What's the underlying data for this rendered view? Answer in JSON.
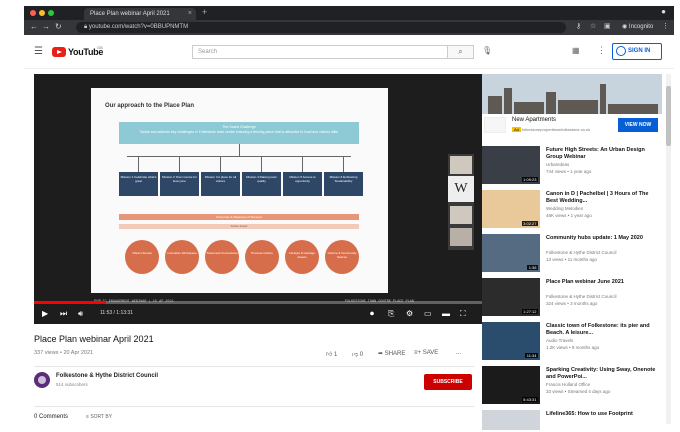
{
  "browser": {
    "tab_title": "Place Plan webinar April 2021",
    "tab_close": "×",
    "new_tab": "+",
    "url": "youtube.com/watch?v=0BBUPNMTM",
    "incognito_label": "Incognito",
    "menu": "⋮"
  },
  "youtube": {
    "logo_text": "YouTube",
    "country": "GB",
    "search_placeholder": "Search",
    "sign_in": "SIGN IN"
  },
  "slide": {
    "title": "Our approach to the Place Plan",
    "challenge_heading": "The Grand Challenge",
    "challenge_text": "Tackle and address key challenges in Folkestone town centre ensuring a thriving place that is attractive to local and visitors alike",
    "missions": [
      "Mission 1 Celebrate what's great",
      "Mission 2 Town Centre for Everyone",
      "Mission 3 A place for all visitors",
      "Mission 4 Raising town quality",
      "Mission 5 Access to opportunity",
      "Mission 6 Embracing Sustainability"
    ],
    "outcomes_label": "Outcomes & Measures of Success",
    "subbar_label": "Action Areas",
    "circles": [
      "Vibrant Streets",
      "Innovative Workspace",
      "Travel and Connections",
      "Promote Culture",
      "Lifestyle & Heritage Assets",
      "Nurture & Community Spaces"
    ],
    "footer_left": "PUBLIC ENGAGEMENT WEBINAR | 15 AP 2021",
    "footer_right": "FOLKESTONE TOWN CENTRE PLACE PLAN",
    "pip_letter": "W"
  },
  "player": {
    "time": "11:53 / 1:13:31",
    "progress_fraction": 0.16
  },
  "video": {
    "title": "Place Plan webinar April 2021",
    "meta": "337 views • 20 Apr 2021",
    "likes": "1",
    "dislikes": "0",
    "share": "SHARE",
    "save": "SAVE",
    "more": "...",
    "channel_name": "Folkestone & Hythe District Council",
    "channel_subs": "514 subscribers",
    "subscribe": "SUBSCRIBE",
    "comments": "0 Comments",
    "sort_by": "SORT BY"
  },
  "ad": {
    "title": "New Apartments",
    "badge": "Ad",
    "url": "folkestonepropertiesmfolkestone.co.uk",
    "cta": "VIEW NOW"
  },
  "recommendations": [
    {
      "title": "Future High Streets: An Urban Design Group Webinar",
      "channel": "UrbanIdeas",
      "meta": "744 views • 1 year ago",
      "duration": "1:09:23",
      "color": "#3a3f47"
    },
    {
      "title": "Canon in D | Pachelbel | 3 Hours of The Best Wedding...",
      "channel": "Wedding Melodies",
      "meta": "48K views • 1 year ago",
      "duration": "3:02:27",
      "color": "#e9c89a"
    },
    {
      "title": "Community hubs update: 1 May 2020",
      "channel": "Folkestone & Hythe District Council",
      "meta": "13 views • 11 months ago",
      "duration": "1:36",
      "color": "#556b82"
    },
    {
      "title": "Place Plan webinar June 2021",
      "channel": "Folkestone & Hythe District Council",
      "meta": "324 views • 3 months ago",
      "duration": "1:27:12",
      "color": "#2c2c2c"
    },
    {
      "title": "Classic town of Folkestone: its pier and Beach. A leisure...",
      "channel": "Audio Travels",
      "meta": "1.2K views • 9 months ago",
      "duration": "11:34",
      "color": "#2a4d6e"
    },
    {
      "title": "Sparking Creativity: Using Sway, Onenote and PowerPoi...",
      "channel": "Francis Holland Office",
      "meta": "33 views • Streamed 4 days ago",
      "duration": "5:43:31",
      "color": "#1b1b1b"
    },
    {
      "title": "Lifeline365: How to use Footprint",
      "channel": "",
      "meta": "",
      "duration": "",
      "color": "#cfd5da"
    }
  ]
}
